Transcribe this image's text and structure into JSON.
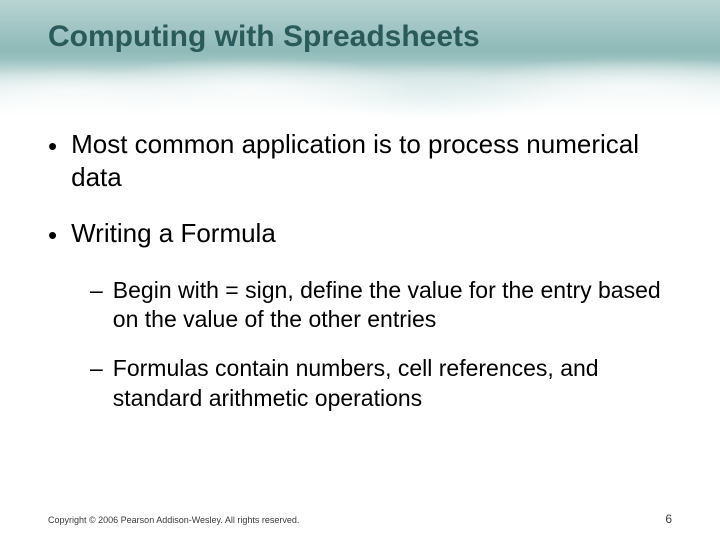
{
  "title": "Computing with Spreadsheets",
  "bullets": [
    {
      "text": "Most common application is to process numerical data",
      "children": []
    },
    {
      "text": "Writing a Formula",
      "children": [
        {
          "text": "Begin with = sign, define the value for the entry based on the value of the other entries"
        },
        {
          "text": "Formulas contain numbers, cell references, and standard arithmetic operations"
        }
      ]
    }
  ],
  "footer": {
    "copyright": "Copyright © 2006 Pearson Addison-Wesley. All rights reserved.",
    "page": "6"
  }
}
